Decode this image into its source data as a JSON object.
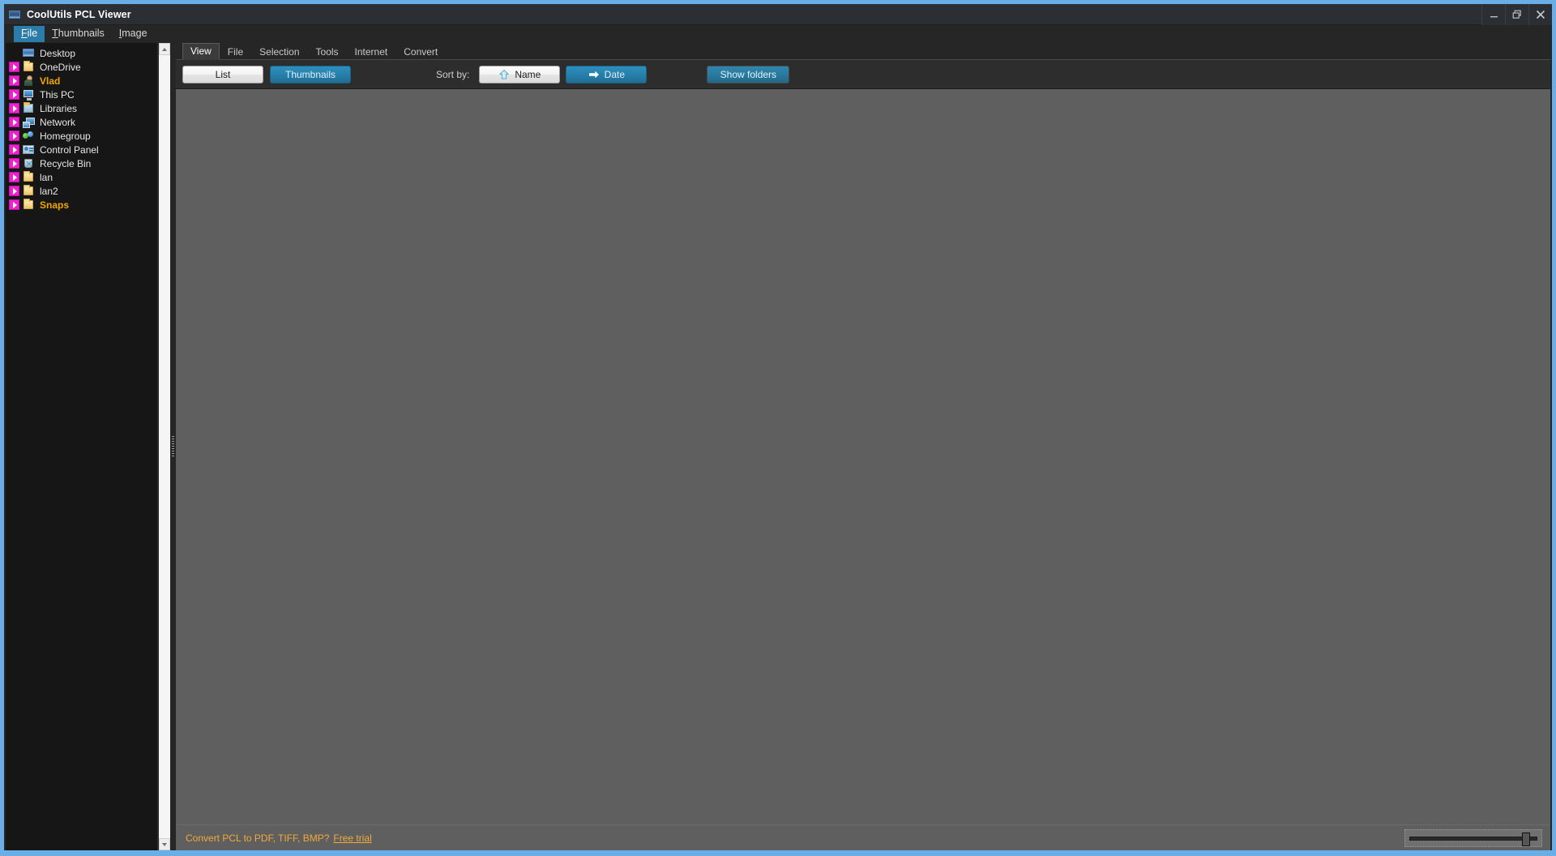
{
  "window": {
    "title": "CoolUtils PCL Viewer",
    "app_icon": "monitor-icon",
    "controls": {
      "minimize": "minimize-icon",
      "restore": "restore-icon",
      "close": "close-icon"
    }
  },
  "menu": {
    "items": [
      {
        "label": "File",
        "mnemonic": "F",
        "active": true
      },
      {
        "label": "Thumbnails",
        "mnemonic": "T",
        "active": false
      },
      {
        "label": "Image",
        "mnemonic": "I",
        "active": false
      }
    ]
  },
  "sidebar": {
    "items": [
      {
        "label": "Desktop",
        "icon": "desktop-icon",
        "expandable": false,
        "highlight": false
      },
      {
        "label": "OneDrive",
        "icon": "folder-icon",
        "expandable": true,
        "highlight": false
      },
      {
        "label": "Vlad",
        "icon": "user-icon",
        "expandable": true,
        "highlight": true
      },
      {
        "label": "This PC",
        "icon": "computer-icon",
        "expandable": true,
        "highlight": false
      },
      {
        "label": "Libraries",
        "icon": "libraries-icon",
        "expandable": true,
        "highlight": false
      },
      {
        "label": "Network",
        "icon": "network-icon",
        "expandable": true,
        "highlight": false
      },
      {
        "label": "Homegroup",
        "icon": "homegroup-icon",
        "expandable": true,
        "highlight": false
      },
      {
        "label": "Control Panel",
        "icon": "control-panel-icon",
        "expandable": true,
        "highlight": false
      },
      {
        "label": "Recycle Bin",
        "icon": "recycle-bin-icon",
        "expandable": true,
        "highlight": false
      },
      {
        "label": "lan",
        "icon": "folder-icon",
        "expandable": true,
        "highlight": false
      },
      {
        "label": "lan2",
        "icon": "folder-icon",
        "expandable": true,
        "highlight": false
      },
      {
        "label": "Snaps",
        "icon": "folder-icon",
        "expandable": true,
        "highlight": true
      }
    ],
    "highlight_color": "#f0a800",
    "expander_color": "#ee22cc"
  },
  "tabs": {
    "items": [
      {
        "label": "View",
        "active": true
      },
      {
        "label": "File",
        "active": false
      },
      {
        "label": "Selection",
        "active": false
      },
      {
        "label": "Tools",
        "active": false
      },
      {
        "label": "Internet",
        "active": false
      },
      {
        "label": "Convert",
        "active": false
      }
    ]
  },
  "toolbar": {
    "list_label": "List",
    "thumbnails_label": "Thumbnails",
    "sort_by_label": "Sort by:",
    "sort_name_label": "Name",
    "sort_name_icon": "arrow-up-icon",
    "sort_date_label": "Date",
    "sort_date_icon": "arrow-right-icon",
    "show_folders_label": "Show folders",
    "accent_blue": "#2680ab"
  },
  "status": {
    "promo_text": "Convert PCL to PDF, TIFF, BMP?",
    "free_trial_label": "Free trial",
    "promo_color": "#f2a93b"
  },
  "content": {
    "background": "#5f5f5f"
  }
}
